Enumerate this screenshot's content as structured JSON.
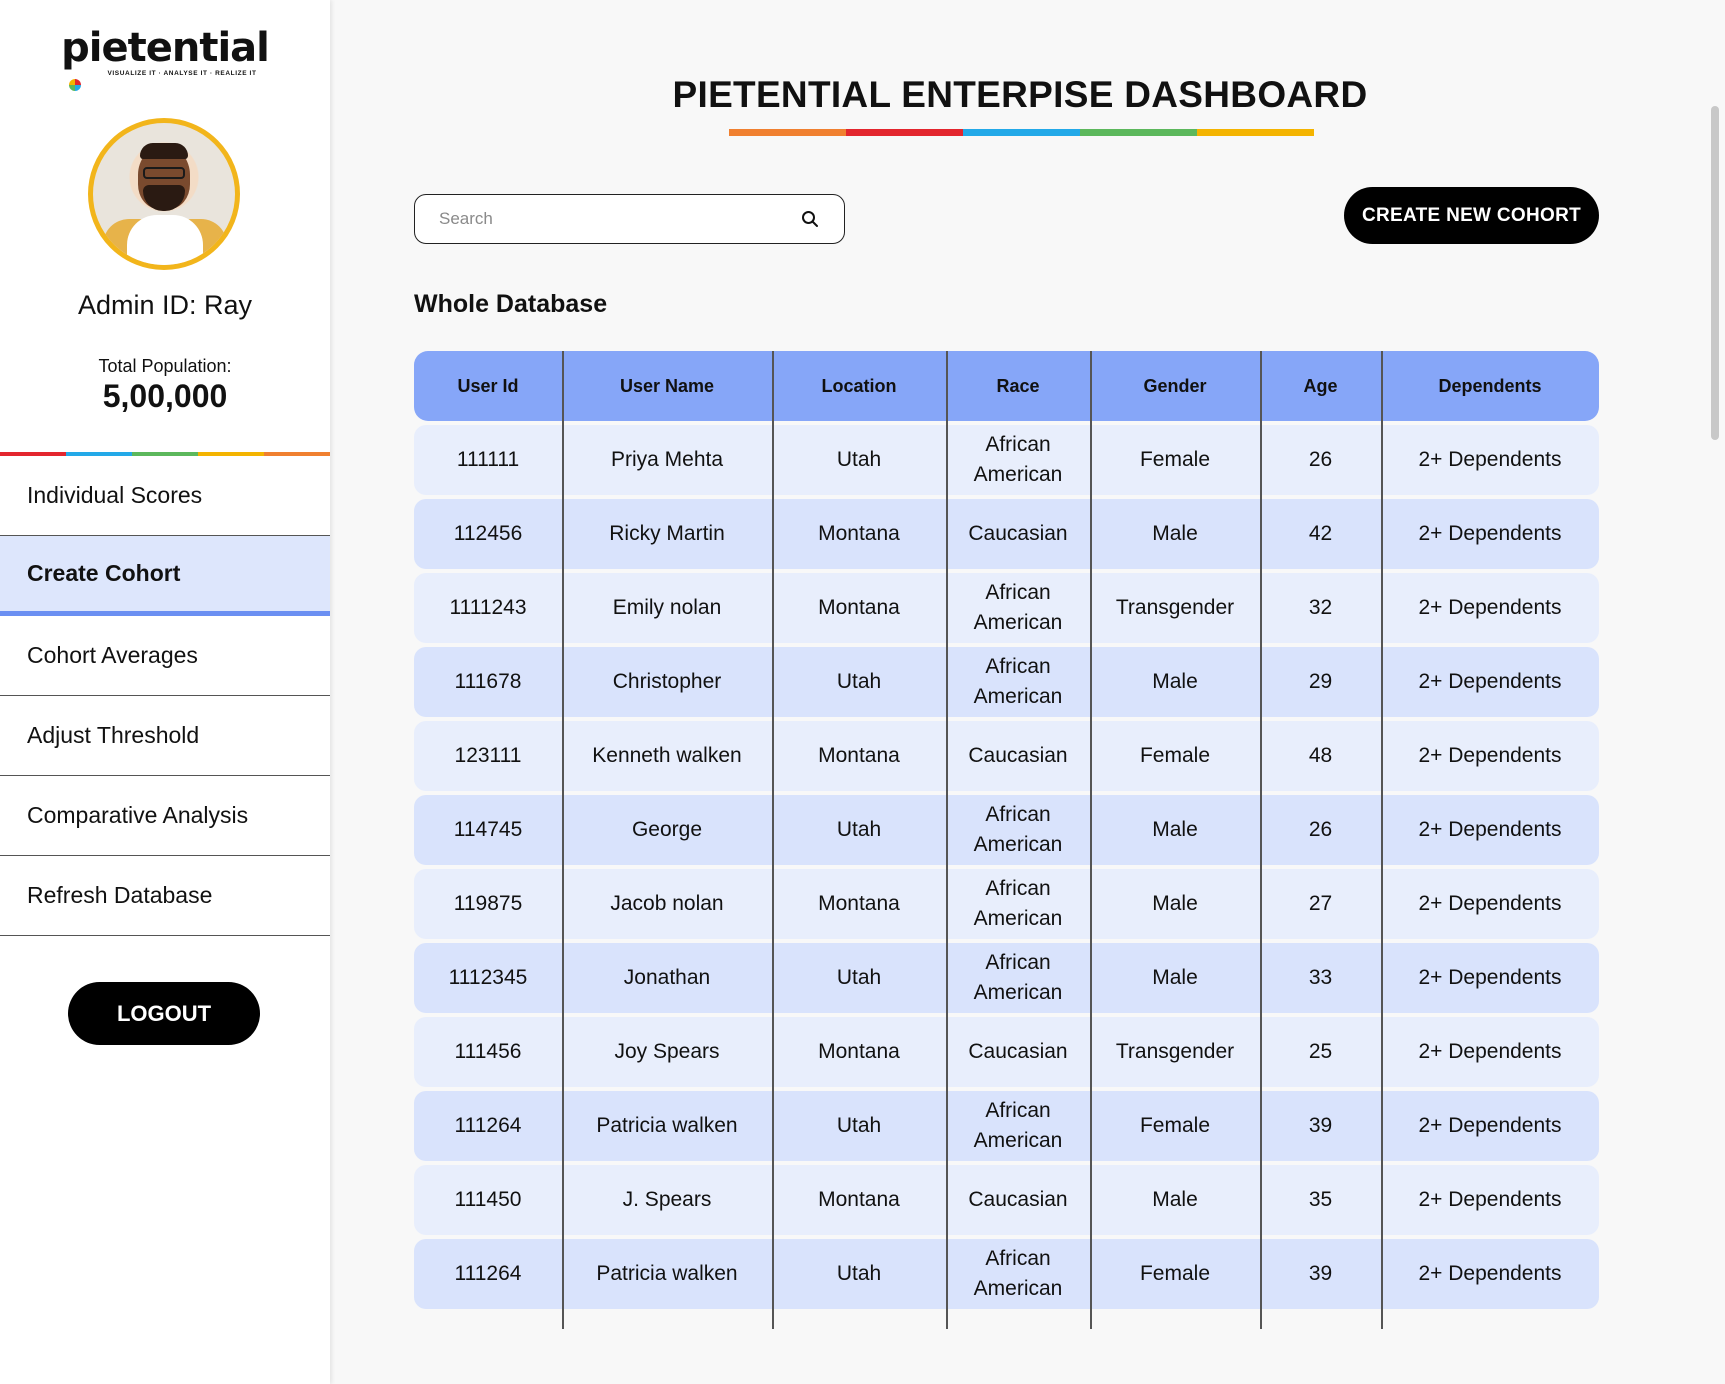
{
  "logo": {
    "word": "pietential",
    "tagline": "VISUALIZE IT · ANALYSE IT · REALIZE IT"
  },
  "profile": {
    "admin_id": "Admin ID: Ray",
    "population_label": "Total Population:",
    "population_value": "5,00,000"
  },
  "brand_colors": [
    "#e3262e",
    "#23a9e8",
    "#5cb85c",
    "#f4b400",
    "#f08030"
  ],
  "nav": [
    {
      "label": "Individual Scores",
      "active": false
    },
    {
      "label": "Create Cohort",
      "active": true
    },
    {
      "label": "Cohort Averages",
      "active": false
    },
    {
      "label": "Adjust Threshold",
      "active": false
    },
    {
      "label": "Comparative Analysis",
      "active": false
    },
    {
      "label": "Refresh Database",
      "active": false
    }
  ],
  "logout_label": "LOGOUT",
  "page_title": "PIETENTIAL ENTERPISE DASHBOARD",
  "search": {
    "placeholder": "Search",
    "value": ""
  },
  "create_button": "CREATE NEW COHORT",
  "section_title": "Whole Database",
  "table": {
    "columns": [
      "User Id",
      "User Name",
      "Location",
      "Race",
      "Gender",
      "Age",
      "Dependents"
    ],
    "rows": [
      [
        "111111",
        "Priya Mehta",
        "Utah",
        "African American",
        "Female",
        "26",
        "2+ Dependents"
      ],
      [
        "112456",
        "Ricky Martin",
        "Montana",
        "Caucasian",
        "Male",
        "42",
        "2+ Dependents"
      ],
      [
        "1111243",
        "Emily nolan",
        "Montana",
        "African American",
        "Transgender",
        "32",
        "2+ Dependents"
      ],
      [
        "111678",
        "Christopher",
        "Utah",
        "African American",
        "Male",
        "29",
        "2+ Dependents"
      ],
      [
        "123111",
        "Kenneth walken",
        "Montana",
        "Caucasian",
        "Female",
        "48",
        "2+ Dependents"
      ],
      [
        "114745",
        "George",
        "Utah",
        "African American",
        "Male",
        "26",
        "2+ Dependents"
      ],
      [
        "119875",
        "Jacob nolan",
        "Montana",
        "African American",
        "Male",
        "27",
        "2+ Dependents"
      ],
      [
        "1112345",
        "Jonathan",
        "Utah",
        "African American",
        "Male",
        "33",
        "2+ Dependents"
      ],
      [
        "111456",
        "Joy Spears",
        "Montana",
        "Caucasian",
        "Transgender",
        "25",
        "2+ Dependents"
      ],
      [
        "111264",
        "Patricia walken",
        "Utah",
        "African American",
        "Female",
        "39",
        "2+ Dependents"
      ],
      [
        "111450",
        "J. Spears",
        "Montana",
        "Caucasian",
        "Male",
        "35",
        "2+ Dependents"
      ],
      [
        "111264",
        "Patricia walken",
        "Utah",
        "African American",
        "Female",
        "39",
        "2+ Dependents"
      ]
    ]
  }
}
